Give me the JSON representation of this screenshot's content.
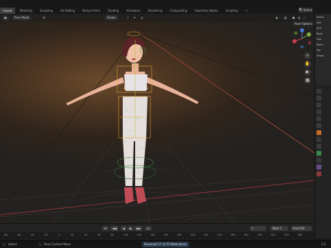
{
  "topbar": {
    "tabs": [
      "Layout",
      "Modeling",
      "Sculpting",
      "UV Editing",
      "Texture Paint",
      "Shading",
      "Animation",
      "Rendering",
      "Compositing",
      "Geometry Nodes",
      "Scripting",
      "+"
    ],
    "active_tab": "Layout",
    "scene_label": "Scene"
  },
  "viewport": {
    "mode_label": "Pose Mode",
    "transform_label": "Global",
    "pose_options_label": "Pose Options"
  },
  "outliner": {
    "rows": [
      "Scene",
      "Coll",
      "Arm",
      "Body",
      "Hair",
      "Pants",
      "Top",
      "Shoes"
    ]
  },
  "timeline": {
    "current_frame": "1",
    "start_label": "Start",
    "start_value": "1",
    "end_label": "End",
    "end_value": "250",
    "ticks": [
      "-80",
      "-60",
      "-40",
      "-20",
      "0",
      "20",
      "40",
      "60",
      "80",
      "100",
      "120",
      "140",
      "160",
      "180",
      "200",
      "220",
      "240",
      "260",
      "280",
      "300",
      "320",
      "340",
      "360"
    ]
  },
  "statusbar": {
    "select_label": "Select",
    "context_menu_label": "Pose Context Menu",
    "message": "Renamed 17 of 25 Materials(s)",
    "version": "3.2"
  },
  "colors": {
    "accent_active": "#e9a43a",
    "x_axis": "#c8404a",
    "y_axis": "#80b040",
    "z_axis": "#4a7bd0"
  }
}
